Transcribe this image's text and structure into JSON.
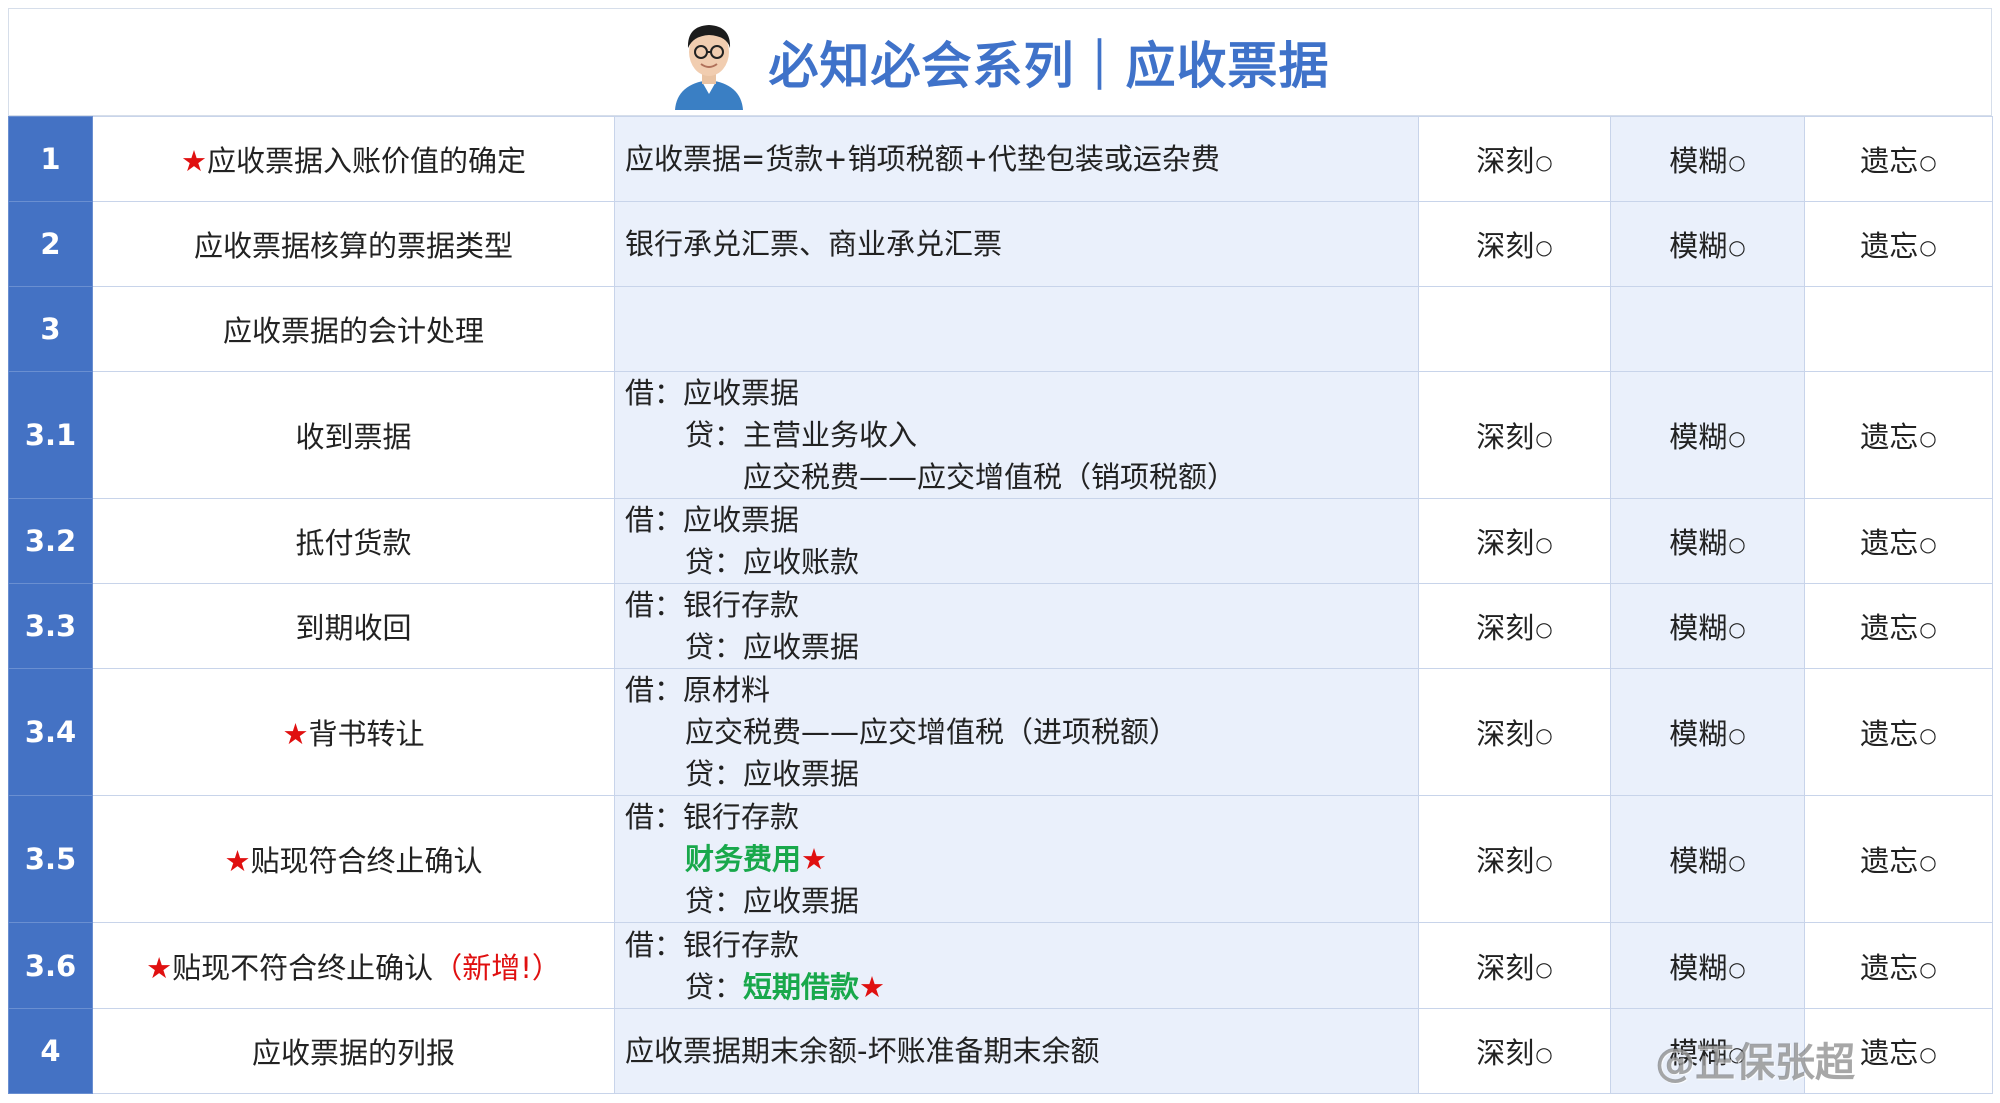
{
  "header": {
    "title": "必知必会系列｜应收票据"
  },
  "options": {
    "deep": "深刻",
    "vague": "模糊",
    "forgot": "遗忘",
    "mark": "○"
  },
  "rows": [
    {
      "num": "1",
      "star": "★",
      "topic": "应收票据入账价值的确定",
      "content": [
        "应收票据=货款+销项税额+代垫包装或运杂费"
      ]
    },
    {
      "num": "2",
      "topic": "应收票据核算的票据类型",
      "content": [
        "银行承兑汇票、商业承兑汇票"
      ]
    },
    {
      "num": "3",
      "topic": "应收票据的会计处理",
      "content": []
    },
    {
      "num": "3.1",
      "topic": "收到票据",
      "content": [
        "借：应收票据",
        "贷：主营业务收入",
        "应交税费——应交增值税（销项税额）"
      ]
    },
    {
      "num": "3.2",
      "topic": "抵付货款",
      "content": [
        "借：应收票据",
        "贷：应收账款"
      ]
    },
    {
      "num": "3.3",
      "topic": "到期收回",
      "content": [
        "借：银行存款",
        "贷：应收票据"
      ]
    },
    {
      "num": "3.4",
      "star": "★",
      "topic": "背书转让",
      "content": [
        "借：原材料",
        "应交税费——应交增值税（进项税额）",
        "贷：应收票据"
      ]
    },
    {
      "num": "3.5",
      "star": "★",
      "topic": "贴现符合终止确认",
      "content": [
        "借：银行存款",
        "财务费用",
        "贷：应收票据"
      ],
      "star_line": "★"
    },
    {
      "num": "3.6",
      "star": "★",
      "topic": "贴现不符合终止确认",
      "note": "（新增!）",
      "content": [
        "借：银行存款",
        "贷：",
        "短期借款"
      ],
      "star_line": "★"
    },
    {
      "num": "4",
      "topic": "应收票据的列报",
      "content": [
        "应收票据期末余额-坏账准备期末余额"
      ]
    }
  ],
  "watermark": "@正保张超"
}
